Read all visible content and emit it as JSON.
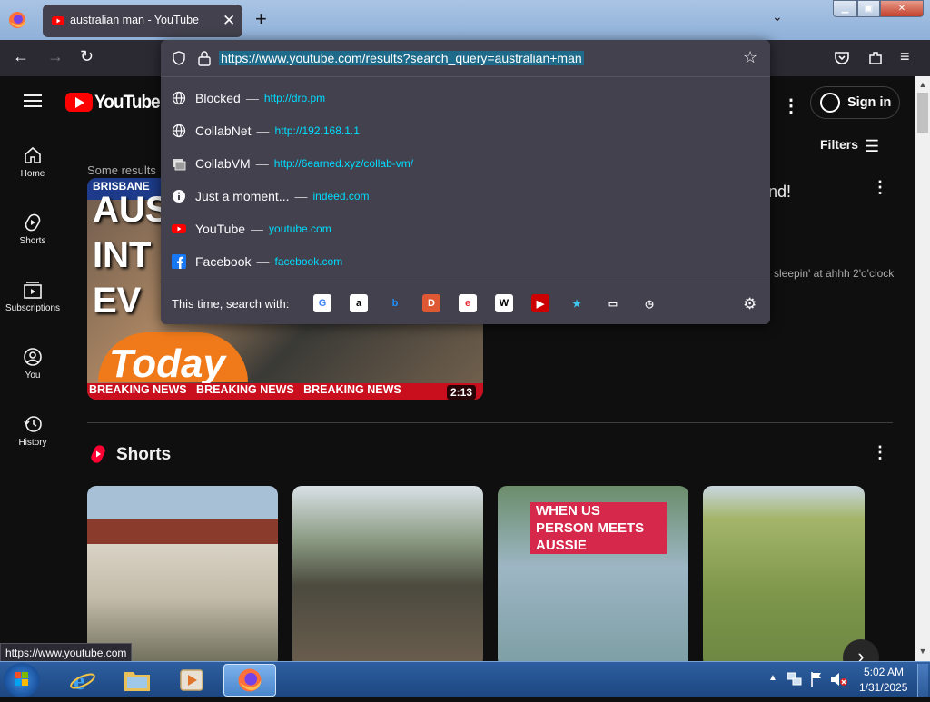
{
  "browser": {
    "tab": {
      "title": "australian man - YouTube",
      "close": "✕"
    },
    "new_tab": "+",
    "url": "https://www.youtube.com/results?search_query=australian+man",
    "status_url": "https://www.youtube.com"
  },
  "url_dropdown": {
    "suggestions": [
      {
        "title": "Blocked",
        "url": "http://dro.pm",
        "icon": "globe-icon"
      },
      {
        "title": "CollabNet",
        "url": "http://192.168.1.1",
        "icon": "globe-icon"
      },
      {
        "title": "CollabVM",
        "url": "http://6earned.xyz/collab-vm/",
        "icon": "collabvm-icon"
      },
      {
        "title": "Just a moment...",
        "url": "indeed.com",
        "icon": "info-icon"
      },
      {
        "title": "YouTube",
        "url": "youtube.com",
        "icon": "youtube-icon"
      },
      {
        "title": "Facebook",
        "url": "facebook.com",
        "icon": "facebook-icon"
      }
    ],
    "dash": "—",
    "search_with_label": "This time, search with:",
    "engines": [
      {
        "name": "google-engine-icon",
        "glyph": "G",
        "color": "#4285f4",
        "bg": "#ffffff"
      },
      {
        "name": "amazon-engine-icon",
        "glyph": "a",
        "color": "#000000",
        "bg": "#ffffff"
      },
      {
        "name": "bing-engine-icon",
        "glyph": "b",
        "color": "#1e90ff",
        "bg": "transparent"
      },
      {
        "name": "duckduckgo-engine-icon",
        "glyph": "D",
        "color": "#ffffff",
        "bg": "#de5833"
      },
      {
        "name": "ebay-engine-icon",
        "glyph": "e",
        "color": "#e53238",
        "bg": "#ffffff"
      },
      {
        "name": "wikipedia-engine-icon",
        "glyph": "W",
        "color": "#000000",
        "bg": "#ffffff"
      },
      {
        "name": "youtube-engine-icon",
        "glyph": "▶",
        "color": "#ffffff",
        "bg": "#cc0000"
      },
      {
        "name": "bookmarks-icon",
        "glyph": "★",
        "color": "#3fc6f0",
        "bg": "transparent"
      },
      {
        "name": "tabs-icon",
        "glyph": "▭",
        "color": "#fbfbfe",
        "bg": "transparent"
      },
      {
        "name": "history-icon",
        "glyph": "◷",
        "color": "#fbfbfe",
        "bg": "transparent"
      }
    ]
  },
  "youtube": {
    "brand": "YouTube",
    "sign_in": "Sign in",
    "filters": "Filters",
    "sidebar": [
      {
        "label": "Home",
        "icon": "home-icon"
      },
      {
        "label": "Shorts",
        "icon": "shorts-icon"
      },
      {
        "label": "Subscriptions",
        "icon": "subscriptions-icon"
      },
      {
        "label": "You",
        "icon": "you-icon"
      },
      {
        "label": "History",
        "icon": "history-icon"
      }
    ],
    "results_note": "Some results",
    "video": {
      "title_fragment": "nd!",
      "description_fragment": "l sleepin' at ahhh 2'o'clock",
      "duration": "2:13",
      "thumb_brisbane": "BRISBANE",
      "thumb_headline": "AUS\nINT\nEV",
      "thumb_today": "Today",
      "thumb_breaking": "BREAKING NEWS   BREAKING NEWS   BREAKING NEWS"
    },
    "shorts_heading": "Shorts",
    "shorts_caption": "WHEN US PERSON MEETS AUSSIE"
  },
  "taskbar": {
    "time": "5:02 AM",
    "date": "1/31/2025"
  },
  "colors": {
    "firefox_toolbar": "#2b2a33",
    "firefox_panel": "#42414d",
    "url_accent": "#00ddff",
    "youtube_red": "#ff0000",
    "youtube_bg": "#0f0f0f"
  }
}
